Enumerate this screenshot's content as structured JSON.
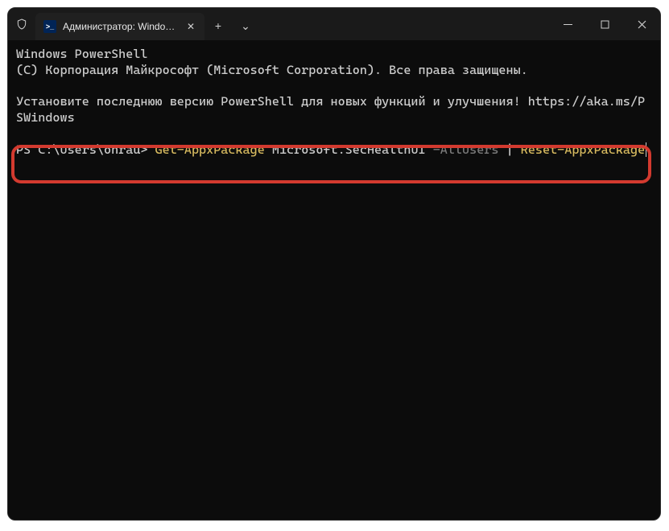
{
  "titlebar": {
    "tab_title": "Администратор: Windows Po",
    "tab_close_glyph": "✕",
    "newtab_glyph": "+",
    "tabmenu_glyph": "⌄",
    "min_glyph": "─",
    "max_glyph": "▢",
    "close_glyph": "✕"
  },
  "terminal": {
    "banner1": "Windows PowerShell",
    "banner2": "(C) Корпорация Майкрософт (Microsoft Corporation). Все права защищены.",
    "notice": "Установите последнюю версию PowerShell для новых функций и улучшения! https://aka.ms/PSWindows",
    "prompt": "PS C:\\Users\\ohrau> ",
    "cmd": {
      "get": "Get-AppxPackage",
      "sp1": " ",
      "arg": "Microsoft.SecHealthUI",
      "sp2": " ",
      "flag": "-AllUsers",
      "sp3": " ",
      "pipe": "|",
      "sp4": " ",
      "reset": "Reset-AppxPackage"
    }
  }
}
